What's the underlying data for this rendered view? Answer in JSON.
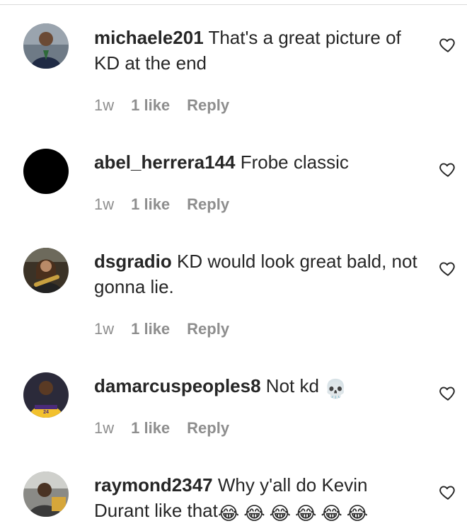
{
  "comments": [
    {
      "username": "michaele201",
      "text": "That's a great picture of KD at the end",
      "time": "1w",
      "likes": "1 like",
      "reply": "Reply",
      "avatar": "photo-person-suit"
    },
    {
      "username": "abel_herrera144",
      "text": "Frobe classic",
      "time": "1w",
      "likes": "1 like",
      "reply": "Reply",
      "avatar": "black-circle"
    },
    {
      "username": "dsgradio",
      "text": "KD would look great bald, not gonna lie.",
      "time": "1w",
      "likes": "1 like",
      "reply": "Reply",
      "avatar": "photo-guitarist"
    },
    {
      "username": "damarcuspeoples8",
      "text": "Not kd",
      "emoji": "💀",
      "time": "1w",
      "likes": "1 like",
      "reply": "Reply",
      "avatar": "photo-lakers-player"
    },
    {
      "username": "raymond2347",
      "text": "Why y'all do Kevin Durant like that",
      "emoji": "😂😂😂😂😂😂",
      "avatar": "photo-person-car"
    }
  ],
  "colors": {
    "text": "#262626",
    "meta": "#8e8e8e",
    "divider": "#dbdbdb"
  }
}
